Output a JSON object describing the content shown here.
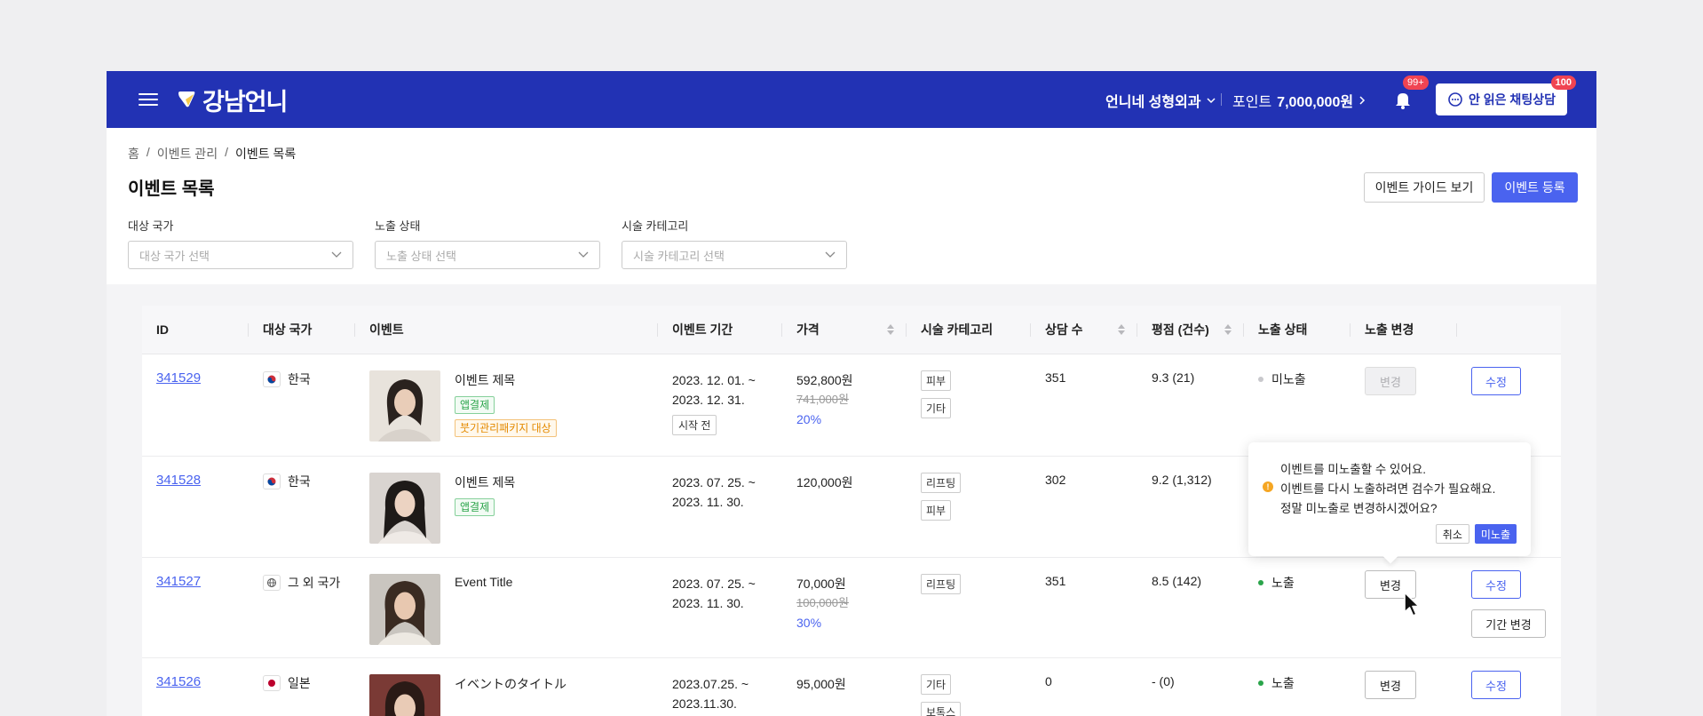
{
  "header": {
    "logo_text": "강남언니",
    "clinic_name": "언니네 성형외과",
    "points_label": "포인트",
    "points_value": "7,000,000원",
    "bell_badge": "99+",
    "chat_label": "안 읽은 채팅상담",
    "chat_badge": "100"
  },
  "breadcrumb": [
    "홈",
    "이벤트 관리",
    "이벤트 목록"
  ],
  "page_title": "이벤트 목록",
  "buttons": {
    "guide": "이벤트 가이드 보기",
    "register": "이벤트 등록"
  },
  "filters": [
    {
      "label": "대상 국가",
      "placeholder": "대상 국가 선택"
    },
    {
      "label": "노출 상태",
      "placeholder": "노출 상태 선택"
    },
    {
      "label": "시술 카테고리",
      "placeholder": "시술 카테고리 선택"
    }
  ],
  "table": {
    "columns": [
      "ID",
      "대상 국가",
      "이벤트",
      "이벤트 기간",
      "가격",
      "시술 카테고리",
      "상담 수",
      "평점 (건수)",
      "노출 상태",
      "노출 변경",
      ""
    ],
    "rows": [
      {
        "id": "341529",
        "flag": "kr",
        "country": "한국",
        "title": "이벤트 제목",
        "tags": [
          "앱결제",
          "붓기관리패키지 대상"
        ],
        "period": [
          "2023. 12. 01. ~",
          "2023. 12. 31."
        ],
        "period_status": "시작 전",
        "price": "592,800원",
        "orig_price": "741,000원",
        "discount": "20%",
        "categories": [
          "피부",
          "기타"
        ],
        "consults": "351",
        "rating": "9.3 (21)",
        "exposure": "미노출",
        "change_label": "변경",
        "edit_label": "수정",
        "period_btn": ""
      },
      {
        "id": "341528",
        "flag": "kr",
        "country": "한국",
        "title": "이벤트 제목",
        "tags": [
          "앱결제"
        ],
        "period": [
          "2023. 07. 25. ~",
          "2023. 11. 30."
        ],
        "period_status": "",
        "price": "120,000원",
        "orig_price": "",
        "discount": "",
        "categories": [
          "리프팅",
          "피부"
        ],
        "consults": "302",
        "rating": "9.2 (1,312)",
        "exposure": "",
        "change_label": "",
        "edit_label": "",
        "period_btn": ""
      },
      {
        "id": "341527",
        "flag": "globe",
        "country": "그 외 국가",
        "title": "Event Title",
        "tags": [],
        "period": [
          "2023. 07. 25. ~",
          "2023. 11. 30."
        ],
        "period_status": "",
        "price": "70,000원",
        "orig_price": "100,000원",
        "discount": "30%",
        "categories": [
          "리프팅"
        ],
        "consults": "351",
        "rating": "8.5 (142)",
        "exposure": "노출",
        "change_label": "변경",
        "edit_label": "수정",
        "period_btn": "기간 변경"
      },
      {
        "id": "341526",
        "flag": "jp",
        "country": "일본",
        "title": "イベントのタイトル",
        "tags": [],
        "period": [
          "2023.07.25. ~",
          "2023.11.30."
        ],
        "period_status": "",
        "price": "95,000원",
        "orig_price": "",
        "discount": "",
        "categories": [
          "기타",
          "보톡스"
        ],
        "consults": "0",
        "rating": "- (0)",
        "exposure": "노출",
        "change_label": "변경",
        "edit_label": "수정",
        "period_btn": ""
      }
    ]
  },
  "popover": {
    "lines": [
      "이벤트를 미노출할 수 있어요.",
      "이벤트를 다시 노출하려면 검수가 필요해요.",
      "정말 미노출로 변경하시겠어요?"
    ],
    "cancel": "취소",
    "confirm": "미노출"
  },
  "colors": {
    "brand": "#2232b4",
    "accent": "#4a63ef",
    "exposed": "#2aa44a",
    "hidden": "#c8c8cc"
  }
}
